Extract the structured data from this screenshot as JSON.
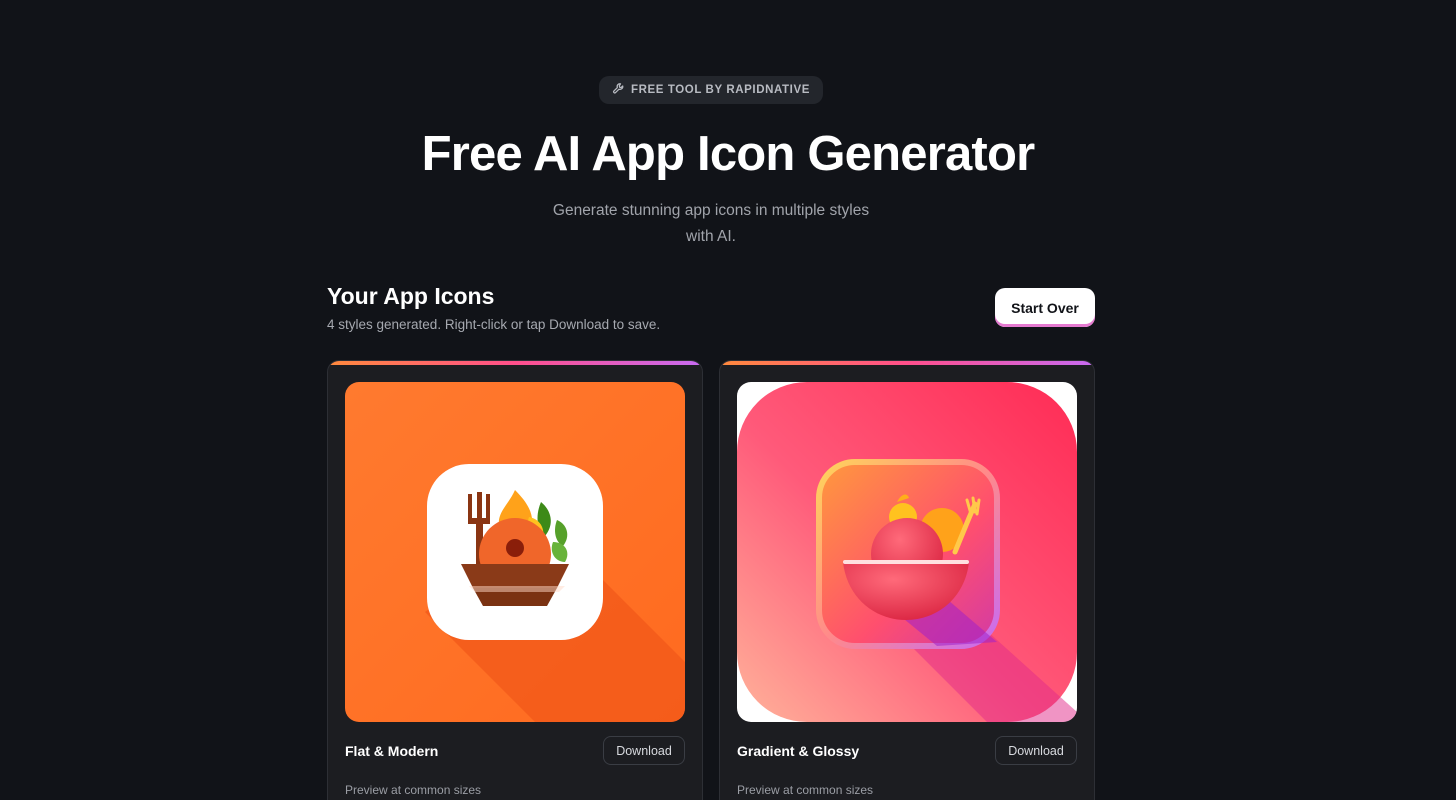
{
  "header": {
    "badge_label": "FREE TOOL BY RAPIDNATIVE",
    "title": "Free AI App Icon Generator",
    "subtitle": "Generate stunning app icons in multiple styles with AI."
  },
  "results": {
    "heading": "Your App Icons",
    "description": "4 styles generated. Right-click or tap Download to save.",
    "start_over_label": "Start Over"
  },
  "cards": [
    {
      "style_name": "Flat & Modern",
      "download_label": "Download",
      "preview_label": "Preview at common sizes"
    },
    {
      "style_name": "Gradient & Glossy",
      "download_label": "Download",
      "preview_label": "Preview at common sizes"
    }
  ],
  "colors": {
    "background": "#111318",
    "card": "#1c1d21",
    "accent_orange": "#ff7a2f",
    "accent_pink": "#ff4f8b",
    "accent_purple": "#c86bf2"
  },
  "icons": [
    "wrench-icon",
    "food-bowl-icon"
  ]
}
